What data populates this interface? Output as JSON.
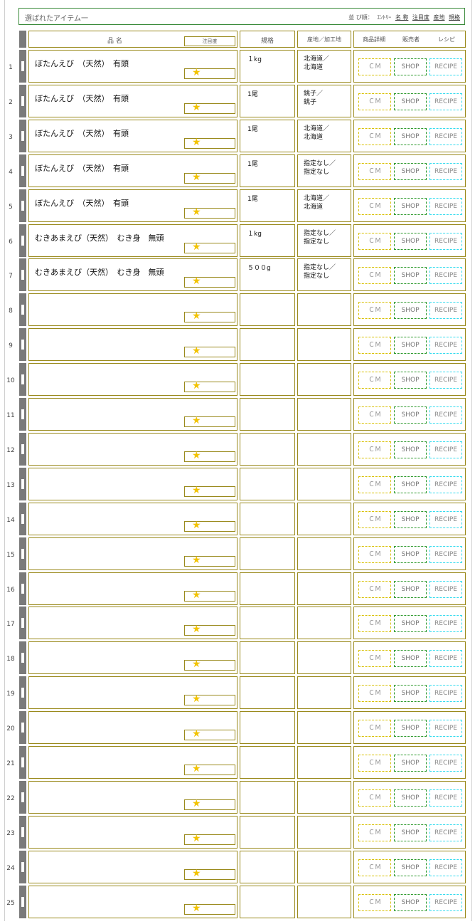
{
  "header": {
    "title": "選ばれたアイテム一",
    "sort_label": "並 び順：",
    "sort_options": [
      "ｴﾝﾄﾘｰ",
      "名 称",
      "注目度",
      "産地",
      "規格"
    ]
  },
  "columns": {
    "name": "品 名",
    "attention": "注目度",
    "spec": "規格",
    "origin": "産地／加工地",
    "detail": "商品詳細",
    "seller": "販売者",
    "recipe": "レシピ"
  },
  "buttons": {
    "cm": "ＣＭ",
    "shop": "SHOP",
    "recipe": "RECIPE"
  },
  "rows": [
    {
      "num": "1",
      "name": "ぼたんえび　（天然）　有頭",
      "spec": "１kg",
      "origin1": "北海道／",
      "origin2": "北海道"
    },
    {
      "num": "2",
      "name": "ぼたんえび　（天然）　有頭",
      "spec": "1尾",
      "origin1": "銚子／",
      "origin2": "銚子"
    },
    {
      "num": "3",
      "name": "ぼたんえび　（天然）　有頭",
      "spec": "1尾",
      "origin1": "北海道／",
      "origin2": "北海道"
    },
    {
      "num": "4",
      "name": "ぼたんえび　（天然）　有頭",
      "spec": "1尾",
      "origin1": "指定なし／",
      "origin2": "指定なし"
    },
    {
      "num": "5",
      "name": "ぼたんえび　（天然）　有頭",
      "spec": "1尾",
      "origin1": "北海道／",
      "origin2": "北海道"
    },
    {
      "num": "6",
      "name": "むきあまえび（天然）　むき身　無頭",
      "spec": "１kg",
      "origin1": "指定なし／",
      "origin2": "指定なし"
    },
    {
      "num": "7",
      "name": "むきあまえび（天然）　むき身　無頭",
      "spec": "５００g",
      "origin1": "指定なし／",
      "origin2": "指定なし"
    },
    {
      "num": "8",
      "name": "",
      "spec": "",
      "origin1": "",
      "origin2": ""
    },
    {
      "num": "9",
      "name": "",
      "spec": "",
      "origin1": "",
      "origin2": ""
    },
    {
      "num": "10",
      "name": "",
      "spec": "",
      "origin1": "",
      "origin2": ""
    },
    {
      "num": "11",
      "name": "",
      "spec": "",
      "origin1": "",
      "origin2": ""
    },
    {
      "num": "12",
      "name": "",
      "spec": "",
      "origin1": "",
      "origin2": ""
    },
    {
      "num": "13",
      "name": "",
      "spec": "",
      "origin1": "",
      "origin2": ""
    },
    {
      "num": "14",
      "name": "",
      "spec": "",
      "origin1": "",
      "origin2": ""
    },
    {
      "num": "15",
      "name": "",
      "spec": "",
      "origin1": "",
      "origin2": ""
    },
    {
      "num": "16",
      "name": "",
      "spec": "",
      "origin1": "",
      "origin2": ""
    },
    {
      "num": "17",
      "name": "",
      "spec": "",
      "origin1": "",
      "origin2": ""
    },
    {
      "num": "18",
      "name": "",
      "spec": "",
      "origin1": "",
      "origin2": ""
    },
    {
      "num": "19",
      "name": "",
      "spec": "",
      "origin1": "",
      "origin2": ""
    },
    {
      "num": "20",
      "name": "",
      "spec": "",
      "origin1": "",
      "origin2": ""
    },
    {
      "num": "21",
      "name": "",
      "spec": "",
      "origin1": "",
      "origin2": ""
    },
    {
      "num": "22",
      "name": "",
      "spec": "",
      "origin1": "",
      "origin2": ""
    },
    {
      "num": "23",
      "name": "",
      "spec": "",
      "origin1": "",
      "origin2": ""
    },
    {
      "num": "24",
      "name": "",
      "spec": "",
      "origin1": "",
      "origin2": ""
    },
    {
      "num": "25",
      "name": "",
      "spec": "",
      "origin1": "",
      "origin2": ""
    }
  ],
  "icons": {
    "star": "star-icon",
    "row_handle": "drag-handle-icon"
  },
  "colors": {
    "border": "#9a8a1c",
    "title_border": "#3a8a3a",
    "star": "#f2c300",
    "cm": "#d8c000",
    "shop": "#2e9a2e",
    "recipe": "#33dbee"
  }
}
